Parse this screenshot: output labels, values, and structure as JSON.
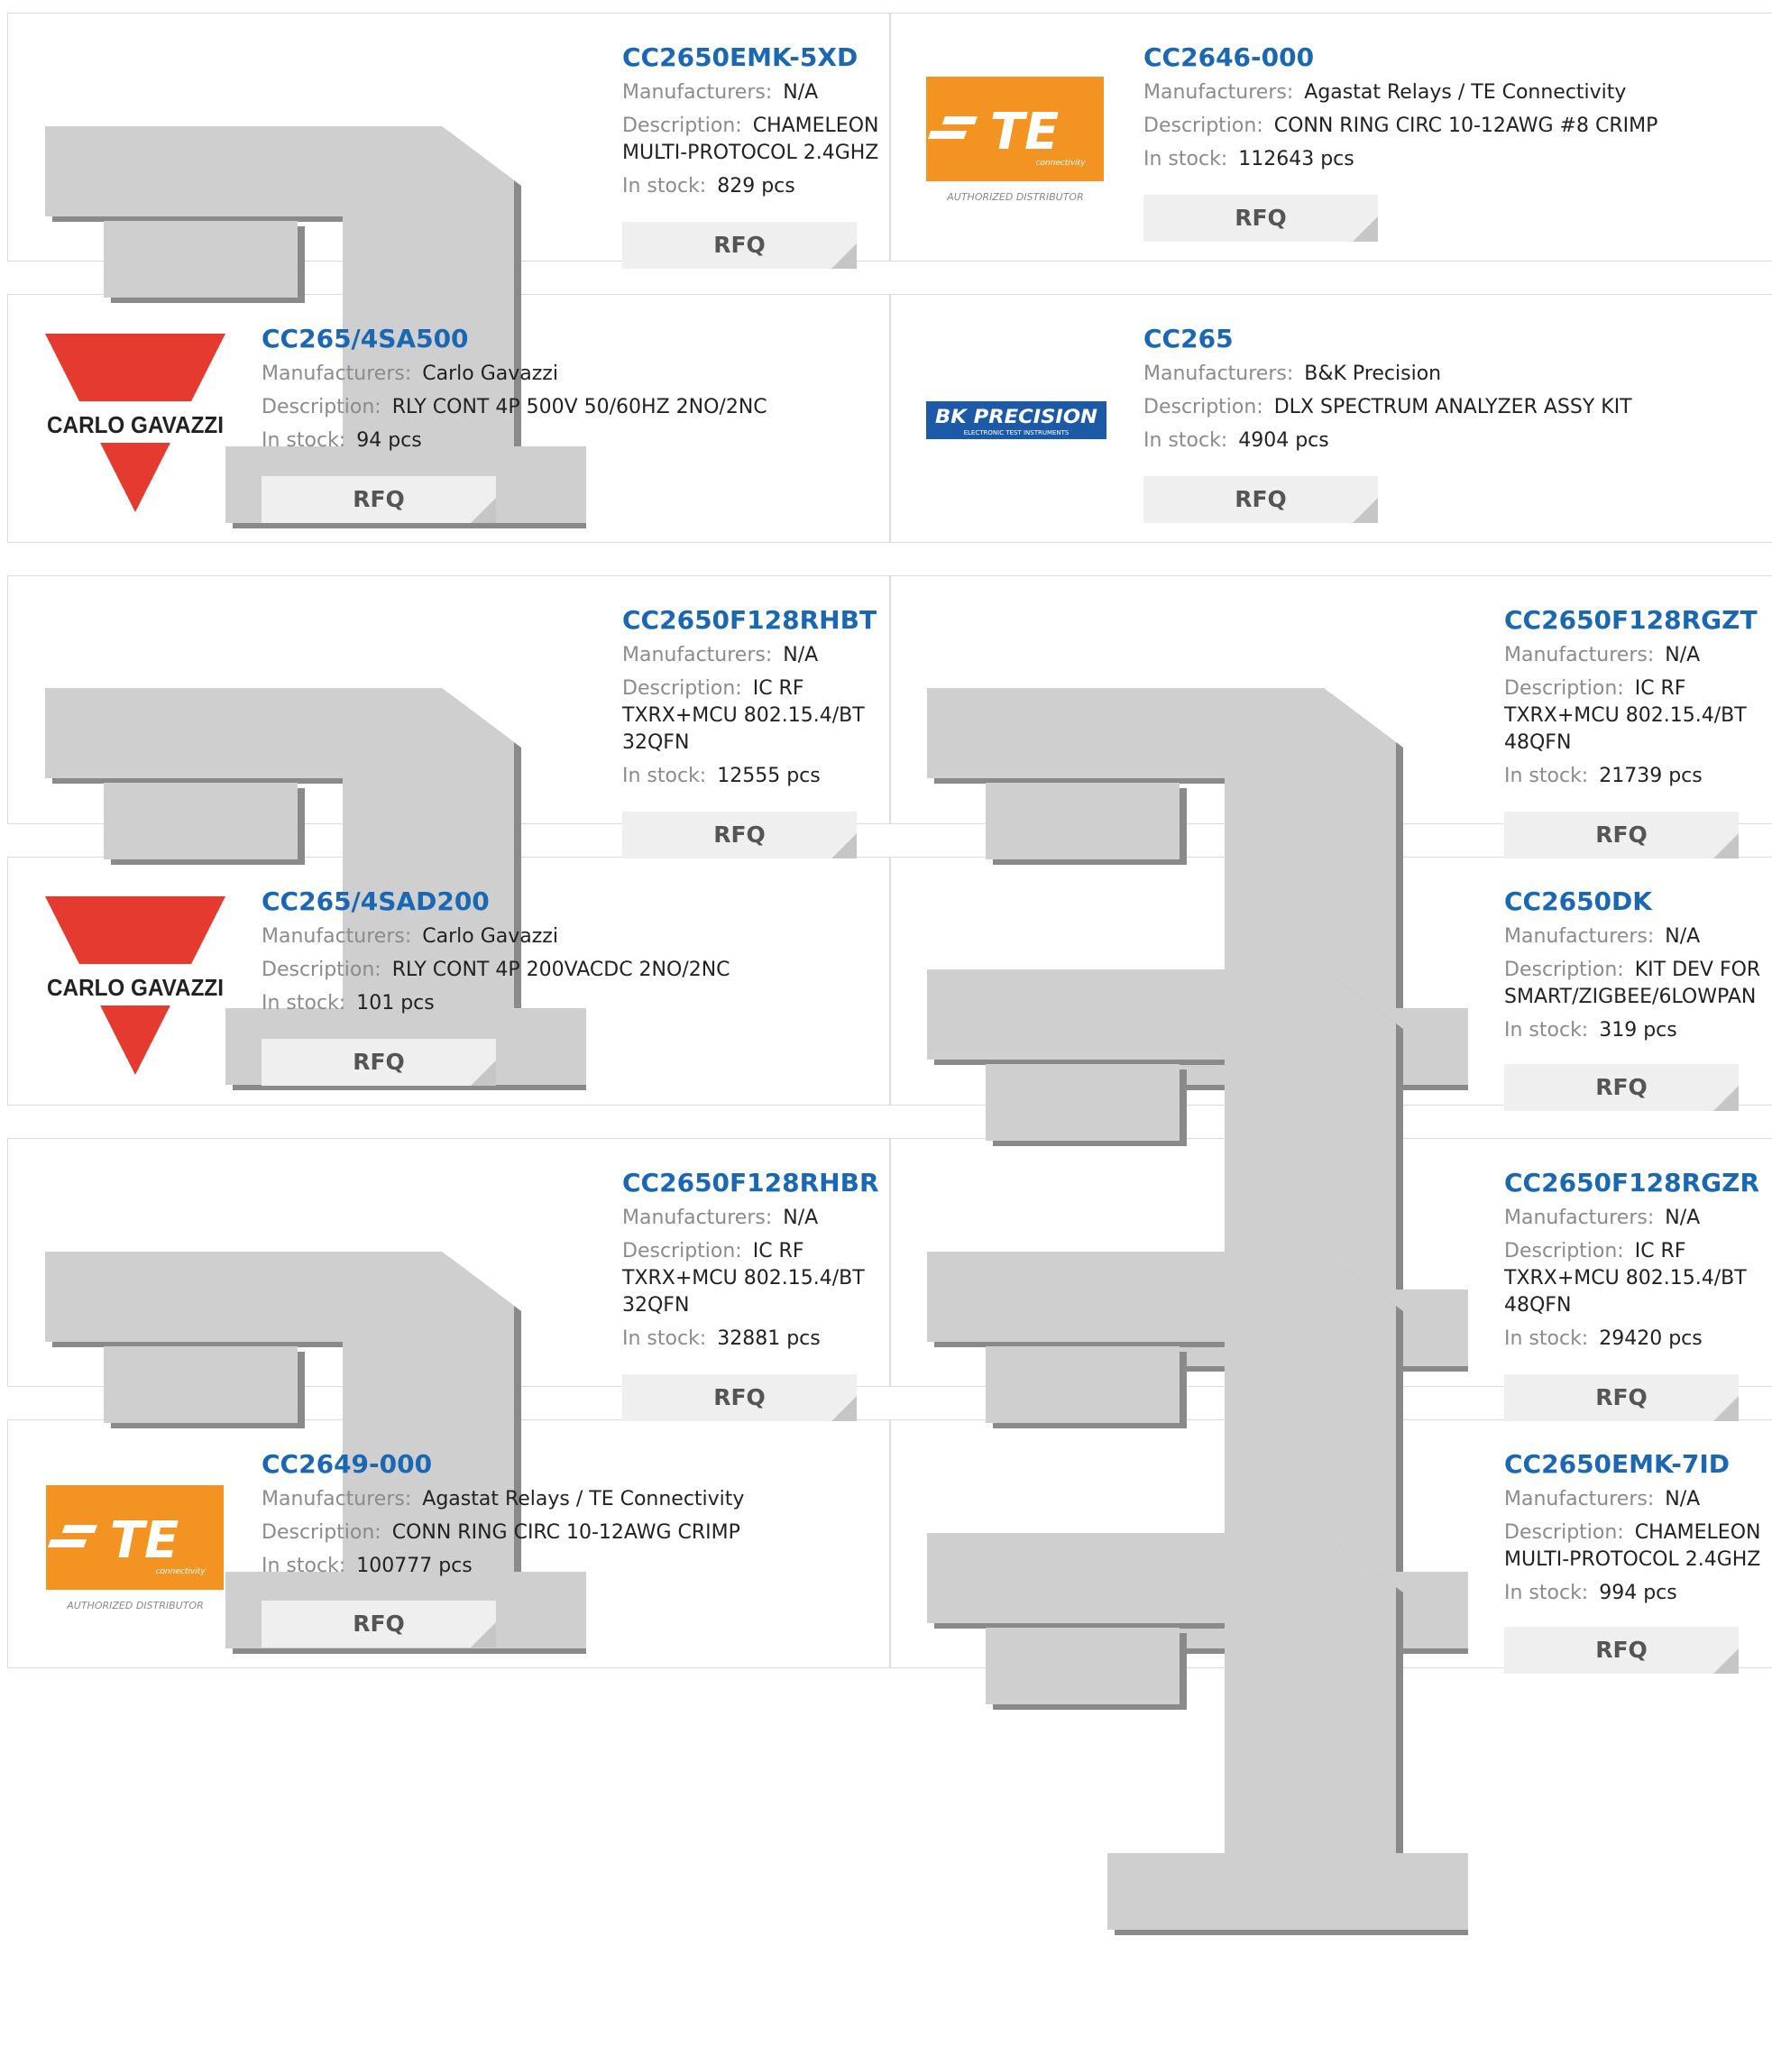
{
  "labels": {
    "manufacturers": "Manufacturers:",
    "description": "Description:",
    "in_stock": "In stock:",
    "rfq": "RFQ"
  },
  "logos": {
    "te_brand": "TE",
    "te_sub": "connectivity",
    "te_badge": "AUTHORIZED DISTRIBUTOR",
    "carlo": "CARLO GAVAZZI",
    "bk": "BK PRECISION",
    "bk_sub": "ELECTRONIC TEST INSTRUMENTS"
  },
  "colors": {
    "part_link": "#1a67b3",
    "te_orange": "#f39322",
    "carlo_red": "#e53a2f",
    "bk_blue": "#1c5aa8"
  },
  "products": [
    {
      "part": "CC2650EMK-5XD",
      "manufacturer": "N/A",
      "description": "CHAMELEON MULTI-PROTOCOL 2.4GHZ",
      "stock": "829 pcs",
      "logo": "placeholder"
    },
    {
      "part": "CC2646-000",
      "manufacturer": "Agastat Relays / TE Connectivity",
      "description": "CONN RING CIRC 10-12AWG #8 CRIMP",
      "stock": "112643 pcs",
      "logo": "te-connectivity"
    },
    {
      "part": "CC265/4SA500",
      "manufacturer": "Carlo Gavazzi",
      "description": "RLY CONT 4P 500V 50/60HZ 2NO/2NC",
      "stock": "94 pcs",
      "logo": "carlo-gavazzi"
    },
    {
      "part": "CC265",
      "manufacturer": "B&K Precision",
      "description": "DLX SPECTRUM ANALYZER ASSY KIT",
      "stock": "4904 pcs",
      "logo": "bk-precision"
    },
    {
      "part": "CC2650F128RHBT",
      "manufacturer": "N/A",
      "description": "IC RF TXRX+MCU 802.15.4/BT 32QFN",
      "stock": "12555 pcs",
      "logo": "placeholder"
    },
    {
      "part": "CC2650F128RGZT",
      "manufacturer": "N/A",
      "description": "IC RF TXRX+MCU 802.15.4/BT 48QFN",
      "stock": "21739 pcs",
      "logo": "placeholder"
    },
    {
      "part": "CC265/4SAD200",
      "manufacturer": "Carlo Gavazzi",
      "description": "RLY CONT 4P 200VACDC 2NO/2NC",
      "stock": "101 pcs",
      "logo": "carlo-gavazzi"
    },
    {
      "part": "CC2650DK",
      "manufacturer": "N/A",
      "description": "KIT DEV FOR SMART/ZIGBEE/6LOWPAN",
      "stock": "319 pcs",
      "logo": "placeholder"
    },
    {
      "part": "CC2650F128RHBR",
      "manufacturer": "N/A",
      "description": "IC RF TXRX+MCU 802.15.4/BT 32QFN",
      "stock": "32881 pcs",
      "logo": "placeholder"
    },
    {
      "part": "CC2650F128RGZR",
      "manufacturer": "N/A",
      "description": "IC RF TXRX+MCU 802.15.4/BT 48QFN",
      "stock": "29420 pcs",
      "logo": "placeholder"
    },
    {
      "part": "CC2649-000",
      "manufacturer": "Agastat Relays / TE Connectivity",
      "description": "CONN RING CIRC 10-12AWG CRIMP",
      "stock": "100777 pcs",
      "logo": "te-connectivity"
    },
    {
      "part": "CC2650EMK-7ID",
      "manufacturer": "N/A",
      "description": "CHAMELEON MULTI-PROTOCOL 2.4GHZ",
      "stock": "994 pcs",
      "logo": "placeholder"
    }
  ]
}
